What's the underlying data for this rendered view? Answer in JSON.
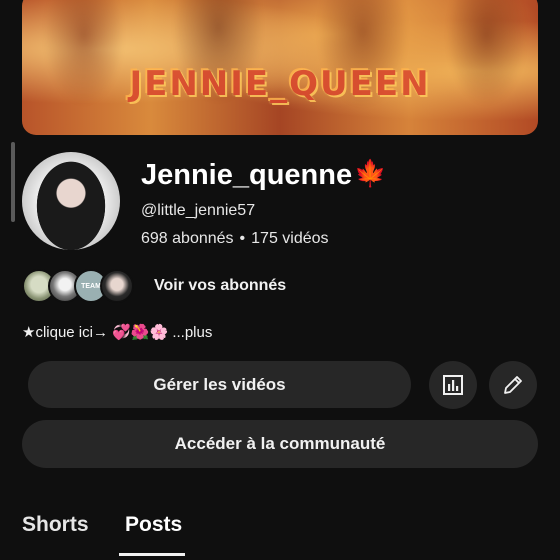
{
  "banner": {
    "text": "JENNIE_QUEEN"
  },
  "channel": {
    "name": "Jennie_quenne",
    "name_emoji": "🍁",
    "handle": "@little_jennie57",
    "subscribers": "698 abonnés",
    "separator": "•",
    "videos": "175 vidéos"
  },
  "subscribers_row": {
    "link_label": "Voir vos abonnés",
    "avatar3_text": "TEAM"
  },
  "bio": {
    "text": "★clique ici→ 💞🌺🌸 ...plus"
  },
  "actions": {
    "manage_videos": "Gérer les vidéos",
    "community": "Accéder à la communauté",
    "stats_icon": "analytics-icon",
    "edit_icon": "pencil-icon"
  },
  "tabs": [
    {
      "label": "Shorts",
      "selected": false
    },
    {
      "label": "Posts",
      "selected": true
    }
  ],
  "colors": {
    "background": "#0f0f0f",
    "button": "#272727",
    "accent": "#e2401c"
  }
}
